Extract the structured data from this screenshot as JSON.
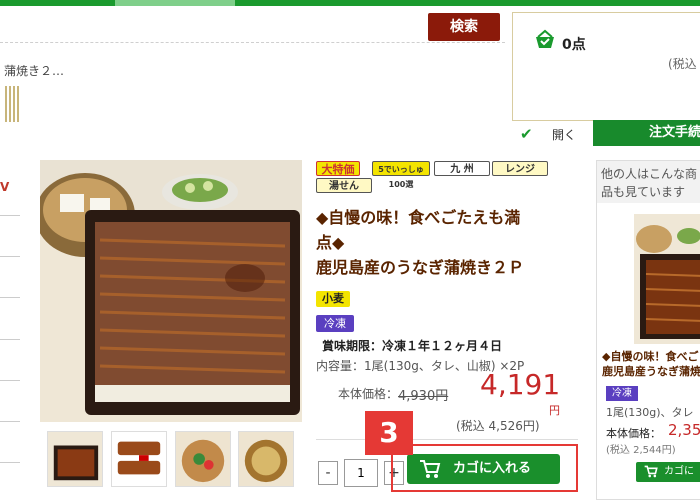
{
  "header": {
    "search_label": "検索"
  },
  "breadcrumb": "蒲焼き２…",
  "cart": {
    "count": "0点",
    "tax_note": "(税込",
    "open_label": "開く",
    "order_label": "注文手続"
  },
  "left_nav": {
    "mark": "V"
  },
  "badges": {
    "special": "大特価",
    "rank": "5でいっしゅ100選",
    "region": "九 州",
    "microwave": "レンジ",
    "boil": "湯せん"
  },
  "product": {
    "title_line1": "◆自慢の味！食べごたえも満",
    "title_line2": "点◆",
    "title_line3": "鹿児島産のうなぎ蒲焼き２Ｐ",
    "allergen": "小麦",
    "storage": "冷凍",
    "expiry": "賞味期限：冷凍１年１２ヶ月４日",
    "content": "内容量：1尾(130g、タレ、山椒) ×2P",
    "price_label": "本体価格：",
    "price_old": "4,930円",
    "price_new": "4,191",
    "price_yen": "円",
    "price_tax": "(税込 4,526円)"
  },
  "purchase": {
    "minus": "-",
    "quantity": "1",
    "plus": "+",
    "add_to_cart": "カゴに入れる",
    "step_number": "3"
  },
  "recommend": {
    "heading": "他の人はこんな商品も見ています",
    "title_line1": "◆自慢の味！食べご",
    "title_line2": "鹿児島産うなぎ蒲焼",
    "storage": "冷凍",
    "content": "1尾(130g)、タレ",
    "price_label": "本体価格：",
    "price": "2,35",
    "tax": "(税込 2,544円)",
    "add_label": "カゴに"
  },
  "colors": {
    "brand_green": "#1a9a2e",
    "price_red": "#c62828",
    "search_bg": "#8b1a0a",
    "highlight": "#e53935",
    "frozen_purple": "#5a3fc0"
  }
}
